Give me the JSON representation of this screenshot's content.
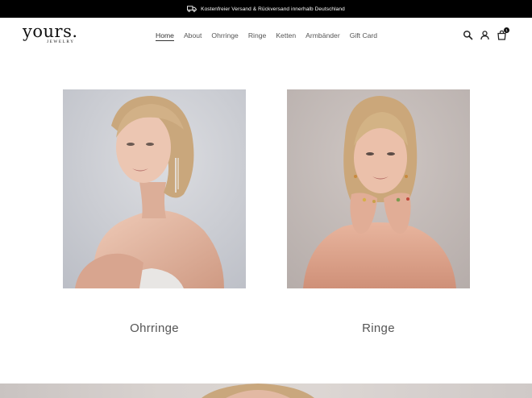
{
  "announcement": {
    "text": "Kostenfreier Versand & Rückversand innerhalb Deutschland",
    "icon": "truck-icon"
  },
  "header": {
    "logo": {
      "main": "yours.",
      "sub": "JEWELRY"
    },
    "nav": [
      {
        "label": "Home",
        "active": true
      },
      {
        "label": "About"
      },
      {
        "label": "Ohrringe"
      },
      {
        "label": "Ringe"
      },
      {
        "label": "Ketten"
      },
      {
        "label": "Armbänder"
      },
      {
        "label": "Gift Card"
      }
    ],
    "icons": [
      "search-icon",
      "account-icon",
      "cart-icon"
    ],
    "cart_count": "1"
  },
  "collections": [
    {
      "title": "Ohrringe",
      "image": "model-with-earrings-photo"
    },
    {
      "title": "Ringe",
      "image": "model-with-rings-photo"
    }
  ],
  "colors": {
    "announcement_bg": "#000000",
    "text": "#3a3a3a",
    "photo_bg_left": "#cfd1d6",
    "photo_bg_right": "#c4bcb9",
    "skin": "#d9a892",
    "hair": "#cfae82"
  }
}
